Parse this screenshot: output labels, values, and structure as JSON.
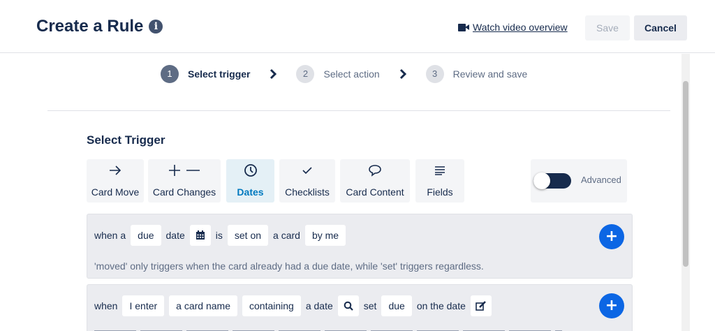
{
  "header": {
    "title": "Create a Rule",
    "info_icon": "info-icon",
    "video_link": "Watch video overview",
    "save_label": "Save",
    "cancel_label": "Cancel"
  },
  "steps": [
    {
      "number": "1",
      "label": "Select trigger",
      "active": true
    },
    {
      "number": "2",
      "label": "Select action",
      "active": false
    },
    {
      "number": "3",
      "label": "Review and save",
      "active": false
    }
  ],
  "trigger": {
    "section_title": "Select Trigger",
    "tabs": [
      {
        "label": "Card Move",
        "icon": "arrow-right-icon"
      },
      {
        "label": "Card Changes",
        "icon": "plus-minus-icon"
      },
      {
        "label": "Dates",
        "icon": "clock-icon",
        "active": true
      },
      {
        "label": "Checklists",
        "icon": "check-icon"
      },
      {
        "label": "Card Content",
        "icon": "speech-bubble-icon"
      },
      {
        "label": "Fields",
        "icon": "lines-icon"
      }
    ],
    "advanced_label": "Advanced",
    "advanced_on": false
  },
  "rules": [
    {
      "w1": "when a",
      "c1": "due",
      "w2": "date",
      "w3": "is",
      "c2": "set on",
      "w4": "a card",
      "c3": "by me",
      "description": "'moved' only triggers when the card already had a due date, while 'set' triggers regardless."
    },
    {
      "w1": "when",
      "c1": "I enter",
      "c2": "a card name",
      "c3": "containing",
      "w2": "a date",
      "w3": "set",
      "c4": "due",
      "w4": "on the date"
    }
  ],
  "colors": {
    "accent": "#0079bf",
    "add_button": "#0c66e4",
    "text": "#172b4d"
  }
}
